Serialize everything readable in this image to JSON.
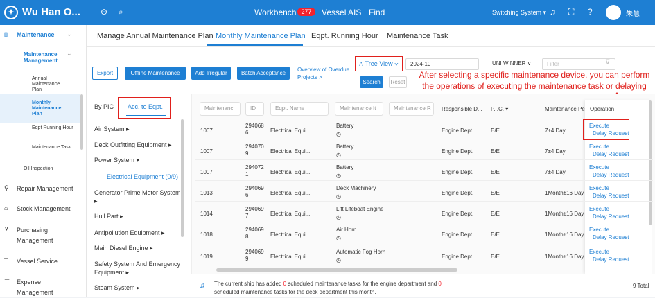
{
  "header": {
    "brand": "Wu Han O...",
    "logo": "✦",
    "nav": [
      {
        "label": "Workbench",
        "badge": "277"
      },
      {
        "label": "Vessel AIS"
      },
      {
        "label": "Find"
      }
    ],
    "switch": "Switching System ▾",
    "user": "朱慧",
    "icons": [
      "collapse-icon",
      "search-icon",
      "bell-icon",
      "fullscreen-icon",
      "help-icon",
      "avatar"
    ]
  },
  "sidebar": {
    "maintenance": "Maintenance",
    "mm": "Maintenance Management",
    "annual": "Annual Maintenance Plan",
    "monthly": "Monthly Maintenance Plan",
    "running": "Eqpt Running Hour",
    "task": "Maintenance Task",
    "oil": "Oil Inspection",
    "repair": "Repair Management",
    "stock": "Stock Management",
    "purchasing": "Purchasing Management",
    "vessel": "Vessel Service",
    "expense": "Expense Management"
  },
  "tabs": [
    "Manage Annual Maintenance Plan",
    "Monthly Maintenance Plan",
    "Eqpt. Running Hour",
    "Maintenance Task"
  ],
  "toolbar": {
    "export": "Export",
    "offline": "Offline Maintenance",
    "add": "Add Irregular",
    "batch": "Batch Acceptance",
    "overview": "Overview of Overdue Projects >",
    "tree": "Tree View ∨",
    "month": "2024-10",
    "ship": "UNI WINNER ∨",
    "filter_ph": "Filter",
    "search": "Search",
    "reset": "Reset"
  },
  "annotation": "After selecting a specific maintenance device, you can perform the operations of executing the maintenance task or delaying request",
  "left": {
    "tab1": "By PIC",
    "tab2": "Acc. to Eqpt.",
    "cats": [
      "Air System ▸",
      "Deck Outfitting Equipment ▸",
      "Power System ▾",
      "Electrical Equipment (0/9)",
      "Generator Prime Motor System ▸",
      "Hull Part ▸",
      "Antipollution Equipment ▸",
      "Main Diesel Engine ▸",
      "Safety System And Emergency Equipment ▸",
      "Steam System ▸"
    ]
  },
  "table": {
    "headers": [
      "Maintenanc",
      "ID",
      "Eqpt. Name",
      "Maintenance It",
      "Maintenance R",
      "Responsible D...",
      "P.I.C. ▾",
      "Maintenance Per",
      "Operation"
    ],
    "rows": [
      {
        "c": "1007",
        "id": "294068 6",
        "name": "Electrical Equi...",
        "item": "Battery",
        "dept": "Engine Dept.",
        "pic": "E/E",
        "period": "7±4 Day"
      },
      {
        "c": "1007",
        "id": "294070 9",
        "name": "Electrical Equi...",
        "item": "Battery",
        "dept": "Engine Dept.",
        "pic": "E/E",
        "period": "7±4 Day"
      },
      {
        "c": "1007",
        "id": "294072 1",
        "name": "Electrical Equi...",
        "item": "Battery",
        "dept": "Engine Dept.",
        "pic": "E/E",
        "period": "7±4 Day"
      },
      {
        "c": "1013",
        "id": "294069 6",
        "name": "Electrical Equi...",
        "item": "Deck Machinery",
        "dept": "Engine Dept.",
        "pic": "E/E",
        "period": "1Month±16 Day"
      },
      {
        "c": "1014",
        "id": "294069 7",
        "name": "Electrical Equi...",
        "item": "Lift Lifeboat Engine",
        "dept": "Engine Dept.",
        "pic": "E/E",
        "period": "1Month±16 Day"
      },
      {
        "c": "1018",
        "id": "294069 8",
        "name": "Electrical Equi...",
        "item": "Air Horn",
        "dept": "Engine Dept.",
        "pic": "E/E",
        "period": "1Month±16 Day"
      },
      {
        "c": "1019",
        "id": "294069 9",
        "name": "Electrical Equi...",
        "item": "Automatic Fog Horn",
        "dept": "Engine Dept.",
        "pic": "E/E",
        "period": "1Month±16 Day"
      }
    ],
    "execute": "Execute",
    "delay": "Delay Request"
  },
  "footer": {
    "p1": "The current ship has added",
    "n1": "0",
    "p2": "scheduled maintenance tasks for the engine department and",
    "n2": "0",
    "p3": "scheduled maintenance tasks for the deck department this month.",
    "total": "9 Total"
  }
}
